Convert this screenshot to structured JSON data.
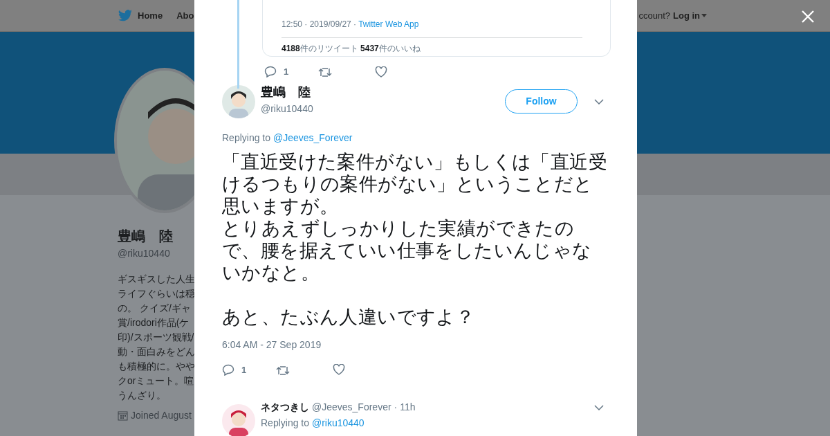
{
  "background_page": {
    "nav": {
      "home": "Home",
      "about": "Abo",
      "account_prompt": "ccount?",
      "login": "Log in"
    },
    "profile": {
      "name": "豊嶋　陸",
      "handle": "@riku10440",
      "bio_lines": [
        "ギスギスした人生",
        "ライフぐらいは穏",
        "の。 クイズ/ギャ",
        "賞/irodori作品(ケ",
        "印)/スポーツ観戦/",
        "動・面白みをどん",
        "も積極的に。やや",
        "クorミュート。喧",
        "うんざり。"
      ],
      "joined": "Joined August"
    }
  },
  "modal": {
    "quoted_tweet": {
      "meta": "12:50 · 2019/09/27 · ",
      "source": "Twitter Web App",
      "stats": "**4188**件のリツイート  **5437**件のいいね"
    },
    "parent_actions": {
      "reply_count": "1"
    },
    "tweet": {
      "name": "豊嶋　陸",
      "handle": "@riku10440",
      "follow": "Follow",
      "replying_label": "Replying to",
      "replying_to": "@Jeeves_Forever",
      "text_blocks": [
        {
          "paragraphs": [
            "「直近受けた案件がない」もしくは「直近受けるつもりの案件がない」ということだと思いますが。",
            "とりあえずしっかりした実績ができたので、腰を据えていい仕事をしたいんじゃないかなと。"
          ]
        },
        {
          "paragraphs": [
            "あと、たぶん人違いですよ？"
          ]
        }
      ],
      "time": "6:04 AM - 27 Sep 2019",
      "reply_count": "1"
    },
    "reply": {
      "name": "ネタつきし",
      "handle": "@Jeeves_Forever",
      "age": "· 11h",
      "replying_label": "Replying to",
      "replying_to": "@riku10440"
    }
  }
}
